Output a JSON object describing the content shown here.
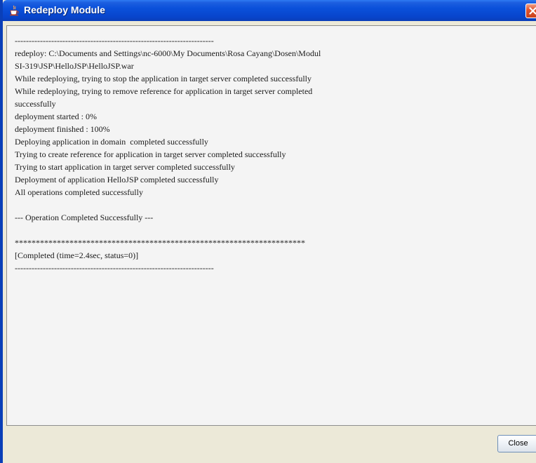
{
  "window": {
    "title": "Redeploy Module",
    "title_icon": "java-cup-icon",
    "close_icon": "close-icon"
  },
  "log": {
    "lines": [
      "-----------------------------------------------------------------------",
      "redeploy: C:\\Documents and Settings\\nc-6000\\My Documents\\Rosa Cayang\\Dosen\\Modul",
      "SI-319\\JSP\\HelloJSP\\HelloJSP.war",
      "While redeploying, trying to stop the application in target server completed successfully",
      "While redeploying, trying to remove reference for application in target server completed",
      "successfully",
      "deployment started : 0%",
      "deployment finished : 100%",
      "Deploying application in domain  completed successfully",
      "Trying to create reference for application in target server completed successfully",
      "Trying to start application in target server completed successfully",
      "Deployment of application HelloJSP completed successfully",
      "All operations completed successfully",
      "",
      "--- Operation Completed Successfully ---",
      "",
      "*********************************************************************",
      "[Completed (time=2.4sec, status=0)]",
      "-----------------------------------------------------------------------"
    ]
  },
  "footer": {
    "close_label": "Close"
  },
  "colors": {
    "titlebar": "#0a50da",
    "content_bg": "#f4f4f4",
    "window_bg": "#ece9d8",
    "close_button": "#e3562f"
  }
}
